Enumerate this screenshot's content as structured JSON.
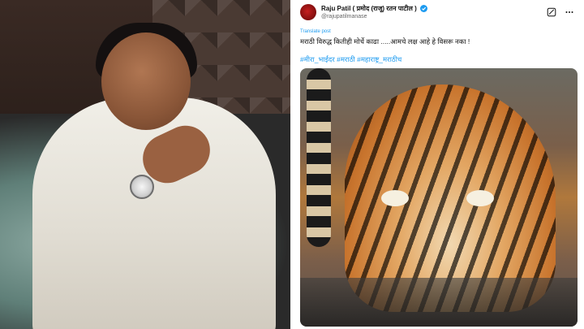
{
  "tweet": {
    "display_name": "Raju Patil ( प्रमोद (राजू) रतन पाटील )",
    "handle": "@rajupatilmanase",
    "translate_label": "Translate post",
    "text": "मराठी विरुद्ध कितीही मोर्चे काढा .....आमचे लक्ष आहे हे विसरू नका !",
    "hashtags": "#मीरा_भाईंदर #मराठी #महाराष्ट्र_मराठीच"
  },
  "icons": {
    "verified": "verified-badge-icon",
    "grok": "grok-icon",
    "more": "more-options-icon"
  },
  "colors": {
    "accent": "#1d9bf0",
    "text": "#111111",
    "muted": "#666666"
  }
}
